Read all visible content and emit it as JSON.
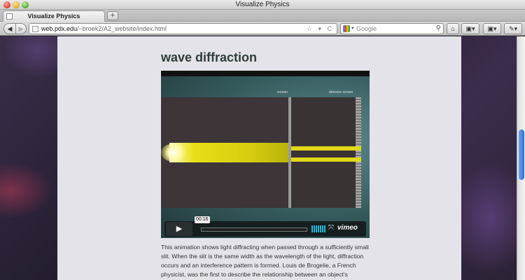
{
  "window": {
    "title": "Visualize Physics"
  },
  "tabs": [
    {
      "label": "Visualize Physics"
    }
  ],
  "newtab_label": "+",
  "nav": {
    "back": "◀",
    "forward": "▶",
    "url_domain": "web.pdx.edu",
    "url_path": "/~broek2/A2_website/index.html",
    "url_icons": "☆ ▾ C",
    "search_placeholder": "Google",
    "search_dropdown": "▾",
    "search_icon": "⚲",
    "home_icon": "⌂",
    "bookmarks_icon": "▣▾",
    "tools_icon": "✎▾"
  },
  "page": {
    "title": "wave diffraction",
    "video": {
      "screen_label": "screen",
      "detector_label": "detector screen",
      "play_icon": "▶",
      "timecode": "00:16",
      "fullscreen_icon": "⤧",
      "brand": "vimeo"
    },
    "description": "This animation shows light diffracting when passed through a sufficiently small slit. When the slit is the same width as the wavelength of the light, diffraction occurs and an interference pattern is formed. Louis de Brogelie, a French physicist, was the first to describe the relationship between an object's"
  },
  "colors": {
    "accent_scroll": "#2f6fcf",
    "title_text": "#2f3c3a",
    "beam": "#e0d818"
  }
}
